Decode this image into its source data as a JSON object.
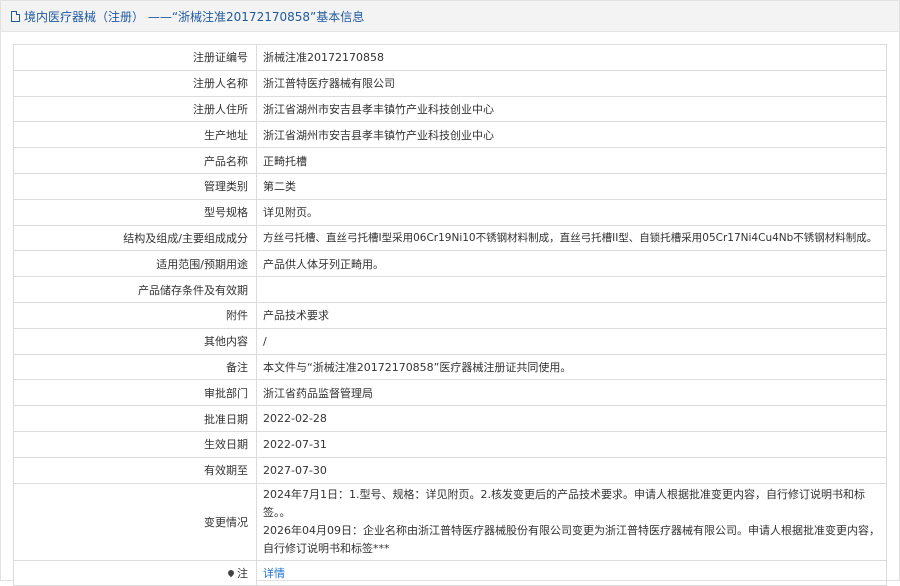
{
  "header": {
    "title": "境内医疗器械（注册） ——“浙械注准20172170858”基本信息"
  },
  "rows": [
    {
      "label": "注册证编号",
      "value": "浙械注准20172170858"
    },
    {
      "label": "注册人名称",
      "value": "浙江普特医疗器械有限公司"
    },
    {
      "label": "注册人住所",
      "value": "浙江省湖州市安吉县孝丰镇竹产业科技创业中心"
    },
    {
      "label": "生产地址",
      "value": "浙江省湖州市安吉县孝丰镇竹产业科技创业中心"
    },
    {
      "label": "产品名称",
      "value": "正畸托槽"
    },
    {
      "label": "管理类别",
      "value": "第二类"
    },
    {
      "label": "型号规格",
      "value": "详见附页。"
    },
    {
      "label": "结构及组成/主要组成成分",
      "value": "方丝弓托槽、直丝弓托槽I型采用06Cr19Ni10不锈钢材料制成，直丝弓托槽II型、自锁托槽采用05Cr17Ni4Cu4Nb不锈钢材料制成。"
    },
    {
      "label": "适用范围/预期用途",
      "value": "产品供人体牙列正畸用。"
    },
    {
      "label": "产品储存条件及有效期",
      "value": ""
    },
    {
      "label": "附件",
      "value": "产品技术要求"
    },
    {
      "label": "其他内容",
      "value": "/"
    },
    {
      "label": "备注",
      "value": "本文件与“浙械注准20172170858”医疗器械注册证共同使用。"
    },
    {
      "label": "审批部门",
      "value": "浙江省药品监督管理局"
    },
    {
      "label": "批准日期",
      "value": "2022-02-28"
    },
    {
      "label": "生效日期",
      "value": "2022-07-31"
    },
    {
      "label": "有效期至",
      "value": "2027-07-30"
    }
  ],
  "change": {
    "label": "变更情况",
    "line1": "2024年7月1日：1.型号、规格：详见附页。2.核发变更后的产品技术要求。申请人根据批准变更内容，自行修订说明书和标签。。",
    "line2": "2026年04月09日：企业名称由浙江普特医疗器械股份有限公司变更为浙江普特医疗器械有限公司。申请人根据批准变更内容，自行修订说明书和标签***"
  },
  "note": {
    "label": "注",
    "link": "详情",
    "icon": "pin-icon"
  }
}
